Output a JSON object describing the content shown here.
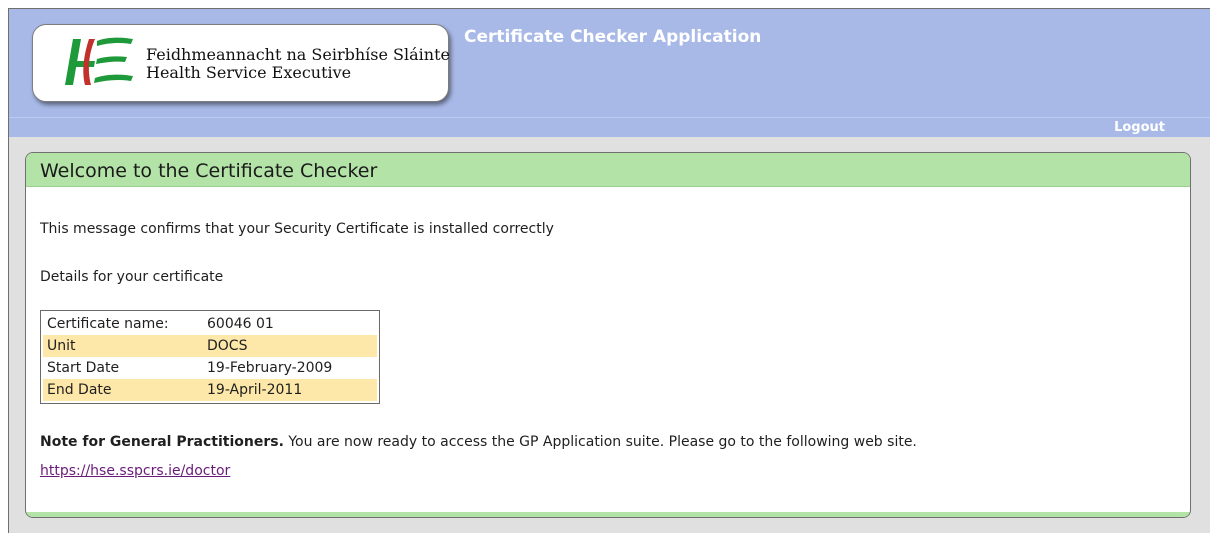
{
  "header": {
    "logo": {
      "line1": "Feidhmeannacht na Seirbhíse Sláinte",
      "line2": "Health Service Executive"
    },
    "app_title": "Certificate Checker Application",
    "logout_label": "Logout",
    "colors": {
      "header_bg": "#a8b9e7",
      "panel_title_bg": "#b3e3a7",
      "row_highlight": "#fde7a9",
      "logo_green": "#1e9a3a",
      "logo_red": "#c0322b"
    }
  },
  "panel": {
    "title": "Welcome to the Certificate Checker",
    "confirm_message": "This message confirms that your Security Certificate is installed correctly",
    "details_heading": "Details for your certificate",
    "certificate": [
      {
        "label": "Certificate name:",
        "value": "60046 01"
      },
      {
        "label": "Unit",
        "value": "DOCS"
      },
      {
        "label": "Start Date",
        "value": "19-February-2009"
      },
      {
        "label": "End Date",
        "value": "19-April-2011"
      }
    ],
    "note_bold": "Note for General Practitioners.",
    "note_text": " You are now ready to access the GP Application suite. Please go to the following web site.",
    "link_text": "https://hse.sspcrs.ie/doctor"
  }
}
